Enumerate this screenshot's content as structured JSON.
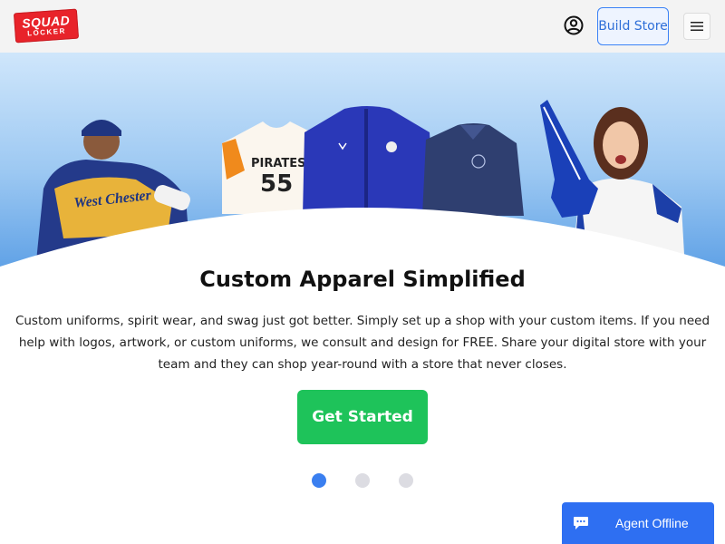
{
  "header": {
    "logo_top": "SQUAD",
    "logo_bottom": "LOCKER",
    "account_icon": "account-circle-icon",
    "build_store_label": "Build Store",
    "menu_icon": "hamburger-menu-icon"
  },
  "hero": {
    "jersey_team": "PIRATES",
    "jersey_number": "55",
    "player_jersey_text": "West Chester",
    "colors": {
      "sky_top": "#cfe6fb",
      "sky_bottom": "#5fa1e6"
    }
  },
  "main": {
    "title": "Custom Apparel Simplified",
    "description": "Custom uniforms, spirit wear, and swag just got better. Simply set up a shop with your custom items. If you need help with logos, artwork, or custom uniforms, we consult and design for FREE. Share your digital store with your team and they can shop year-round with a store that never closes.",
    "cta_label": "Get Started",
    "carousel": {
      "count": 3,
      "active_index": 0
    }
  },
  "chat": {
    "icon": "chat-bubble-icon",
    "label": "Agent Offline"
  },
  "colors": {
    "accent_green": "#1ec35a",
    "accent_blue": "#3a7ff0",
    "brand_red": "#e8232a"
  }
}
